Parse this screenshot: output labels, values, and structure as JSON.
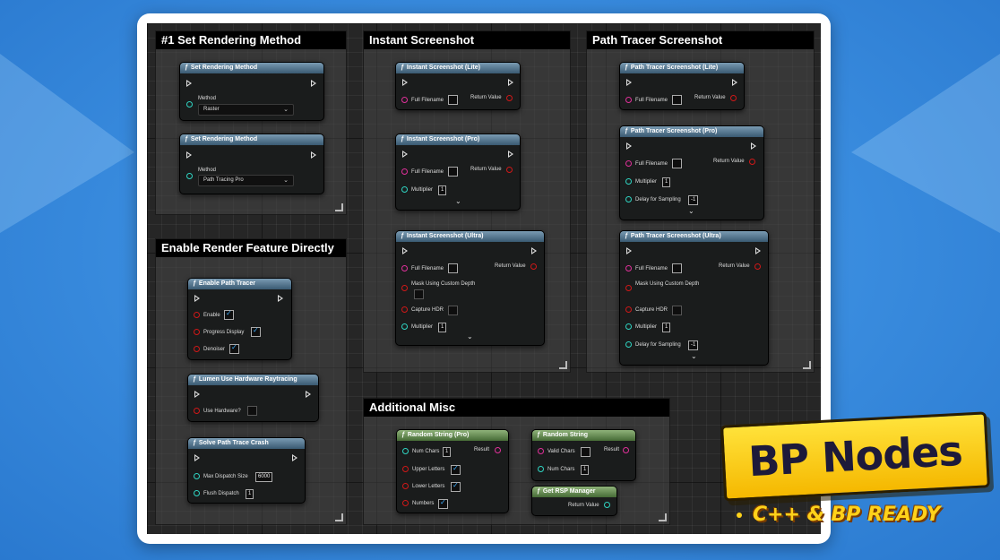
{
  "comments": {
    "set_rendering": "#1 Set Rendering Method",
    "instant": "Instant Screenshot",
    "path_tracer": "Path Tracer Screenshot",
    "enable_render": "Enable Render Feature Directly",
    "misc": "Additional Misc"
  },
  "labels": {
    "method": "Method",
    "full_filename": "Full Filename",
    "return_value": "Return Value",
    "multiplier": "Multiplier",
    "mask_custom_depth": "Mask Using Custom Depth",
    "capture_hdr": "Capture HDR",
    "delay_sampling": "Delay for Sampling",
    "enable": "Enable",
    "progress_display": "Progress Display",
    "denoiser": "Denoiser",
    "use_hardware": "Use Hardware?",
    "max_dispatch": "Max Dispatch Size",
    "flush_dispatch": "Flush Dispatch",
    "num_chars": "Num Chars",
    "upper_letters": "Upper Letters",
    "lower_letters": "Lower Letters",
    "numbers": "Numbers",
    "result": "Result",
    "valid_chars": "Valid Chars"
  },
  "nodes": {
    "set_method_1": {
      "title": "Set Rendering Method",
      "method_value": "Raster"
    },
    "set_method_2": {
      "title": "Set Rendering Method",
      "method_value": "Path Tracing Pro"
    },
    "inst_lite": {
      "title": "Instant Screenshot (Lite)"
    },
    "inst_pro": {
      "title": "Instant Screenshot (Pro)",
      "multiplier": "1"
    },
    "inst_ultra": {
      "title": "Instant Screenshot (Ultra)",
      "multiplier": "1"
    },
    "pt_lite": {
      "title": "Path Tracer Screenshot (Lite)"
    },
    "pt_pro": {
      "title": "Path Tracer Screenshot (Pro)",
      "multiplier": "1",
      "delay": "-1"
    },
    "pt_ultra": {
      "title": "Path Tracer Screenshot (Ultra)",
      "multiplier": "1",
      "delay": "-1"
    },
    "enable_pt": {
      "title": "Enable Path Tracer"
    },
    "lumen": {
      "title": "Lumen Use Hardware Raytracing"
    },
    "solve_crash": {
      "title": "Solve Path Trace Crash",
      "max_dispatch": "6000",
      "flush": "1"
    },
    "rand_pro": {
      "title": "Random String (Pro)",
      "num_chars": "1"
    },
    "rand": {
      "title": "Random String",
      "num_chars": "1"
    },
    "rsp": {
      "title": "Get RSP Manager"
    }
  },
  "banner": {
    "title": "BP Nodes",
    "subtitle": "C++ & BP READY"
  },
  "icons": {
    "function": "function-icon",
    "exec": "exec-pin-icon",
    "chevron": "chevron-down-icon",
    "expand": "expand-arrow-icon"
  },
  "colors": {
    "background": "#3b8ee0",
    "banner": "#f5b800",
    "pin_cyan": "#2fd4c2",
    "pin_pink": "#e0309a",
    "pin_red": "#d01818"
  }
}
